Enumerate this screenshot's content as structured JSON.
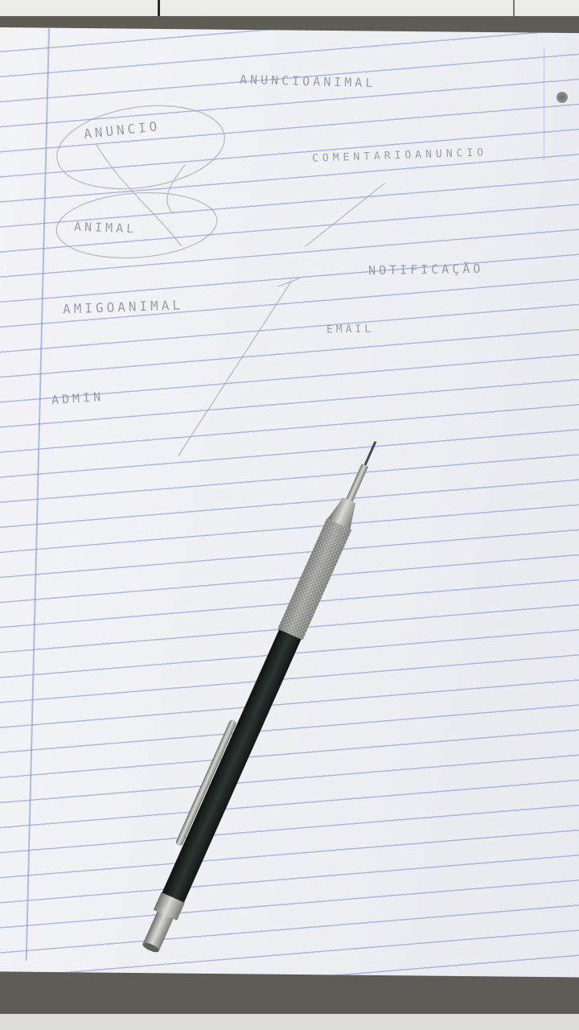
{
  "notes": {
    "title": "ANUNCIOANIMAL",
    "entity_anuncio": "ANUNCIO",
    "entity_comentario": "COMENTARIOANUNCIO",
    "entity_animal": "ANIMAL",
    "entity_notificacao": "NOTIFICAÇÃO",
    "entity_amigo": "AMIGOANIMAL",
    "entity_email": "EMAIL",
    "entity_admin": "ADMIN"
  },
  "colors": {
    "paper": "#eef0f4",
    "rule_lines": "#7887d7",
    "graphite": "#8f8f96",
    "pencil_barrel": "#1d2322",
    "pencil_metal": "#b5b5b2"
  }
}
